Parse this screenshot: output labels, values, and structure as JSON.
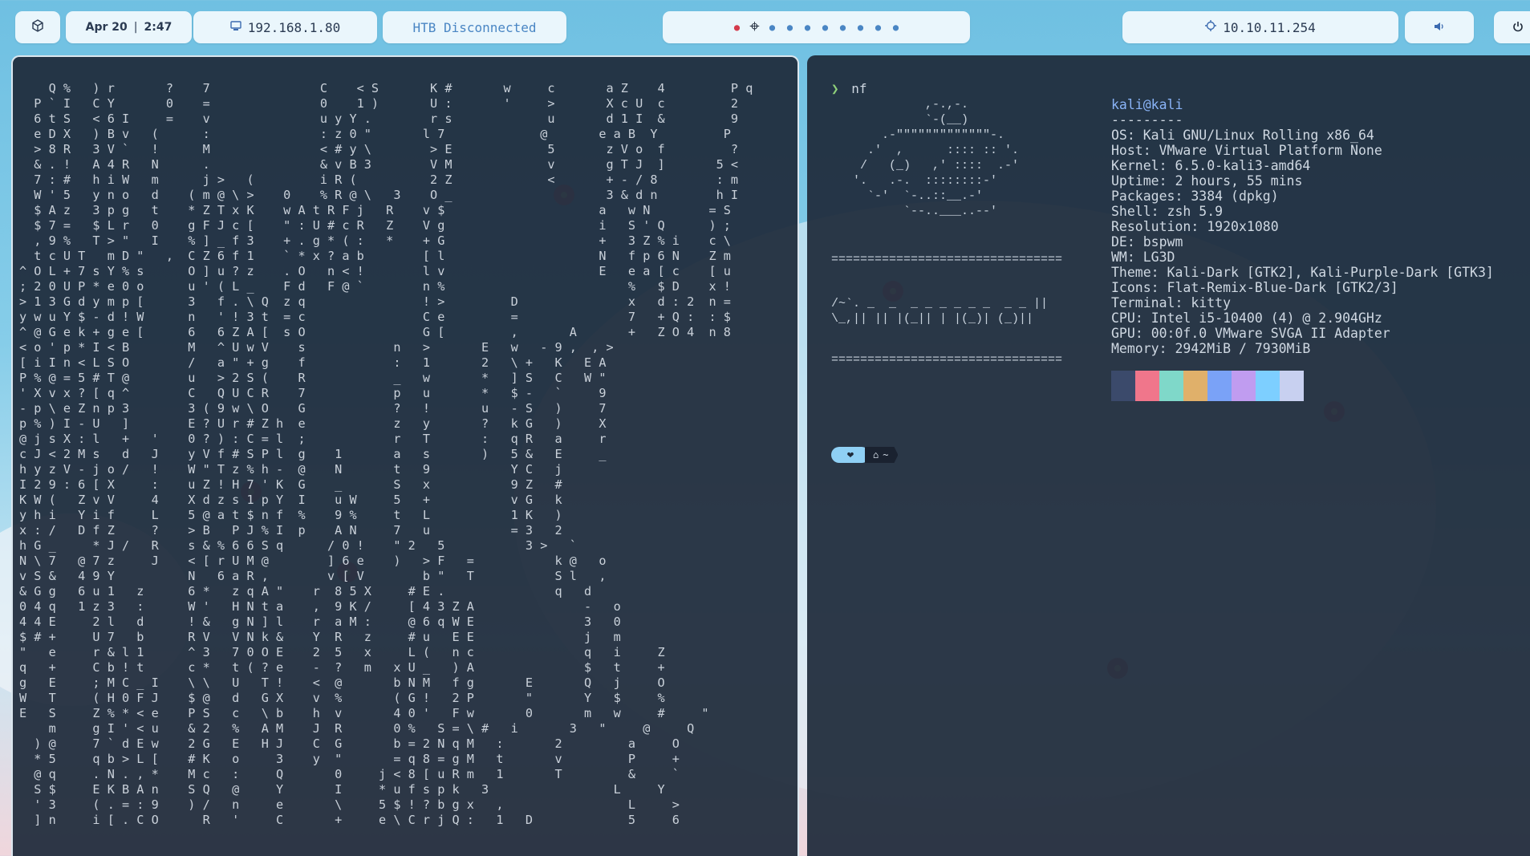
{
  "topbar": {
    "logo_icon": "cube-icon",
    "clock": {
      "date": "Apr 20",
      "time": "2:47"
    },
    "lan": {
      "icon": "network-icon",
      "ip": "192.168.1.80"
    },
    "htb_status": "HTB Disconnected",
    "workspaces": {
      "count": 10,
      "active_index": 1,
      "urgent_index": 0
    },
    "vpn": {
      "icon": "target-icon",
      "ip": "10.10.11.254"
    },
    "volume_icon": "volume-icon",
    "power_icon": "power-icon"
  },
  "left_terminal": {
    "matrix_text": "    Q %   ) r       ?    7               C    < S       K #       w     c       a Z    4         P q\n  P ` I   C Y       0    =               0    1 )       U :       '     >       X c U  c         2\n  6 t S   < 6 I     =    v               u y Y .        r s             u       d 1 I  &         9\n  e D X   ) B v   (      :               : z 0 \"       l 7             @       e a B  Y         P\n  > 8 R   3 V `   !      M               < # y \\        > E             5       z V o  f         ?\n  & . !   A 4 R   N      .               & v B 3        V M             v       g T J  ]       5 <\n  7 : #   h i W   m      j >   (         i R (          2 Z             <       + - / 8        : m\n  W ' 5   y n o   d    ( m @ \\ >    0    % R @ \\   3    O _                     3 & d n        h I\n  $ A z   3 p g   t    * Z T x K    w A t R F j   R    v $                     a   w N        = S\n  $ 7 =   $ L r   0    g F J c [    \" : U # c R   Z    V g                     i   S ' Q      ) ;\n  , 9 %   T > \"   I    % ] _ f 3    + . g * ( :   *    + G                     +   3 Z % i    c \\\n  t c U T   m D \"   ,  C Z 6 f 1    ` * x ? a b        [ l                     N   f p 6 N    Z m\n^ O L + 7 s Y % s      O ] u ? z    . O   n < !        l v                     E   e a [ c    [ u\n; 2 0 U P * e 0 o      u ' ( L _    F d   F @ `        n %                         %   $ D    x !\n> 1 3 G d y m p [      3   f . \\ Q  z q                ! >         D               x   d : 2  n =\ny w u Y $ - d ! W      n   ' ! 3 t  = c                C e         =               7   + Q :  : $\n^ @ G e k + g e [      6   6 Z A [  s O                G [         ,       A       +   Z O 4  n 8\n< o ' p * I < B        M   ^ U w V    s            n   >       E   w   - 9 ,  , >\n[ i I n < L S O        /   a \" + g    f            :   1       2   \\ +   K   E A\nP % @ = 5 # T @        u   > 2 S (    R            _   w       *   ] S   C   W \"\n' X v x ? [ q ^        C   Q U C R    7            p   u       *   $ -   `     9\n- p \\ e Z n p 3        3 ( 9 w \\ O    G            ?   !       u   - S   )     7\np % ) I - U   ]        E ? U r # Z h  e            z   y       ?   k G   )     X\n@ j s X : l   +   '    0 ? ) : C = l  ;            r   T       :   q R   a     r\nc J < 2 M s   d   J    y V f # S P l  g    1       a   s       )   5 &   E     _\nh y z V - j o /   !    W \" T z % h -  @    N       t   9           Y C   j\nI 2 9 : 6 [ X     :    u Z ! H 7 ' K  G    _       S   x           9 Z   #\nK W (   Z v V     4    X d z s 1 p Y  I    u W     5   +           v G   k\ny h i   Y i f     L    5 @ a t $ n f  %    9 %     t   L           1 K   )\nx : /   D f Z     ?    > B   P J % I  p    A N     7   u           = 3   2\nh G _     * J /   R    s & % 6 6 S q      / 0 !    \" 2   5           3 >   `\nN \\ 7   @ 7 z     J    < [ r U M @        ] 6 e    )   > F   =           k @   o\nv S &   4 9 Y          N   6 a R ,        v [ V        b \"   T           S l   ,\n& G g   6 u 1   z      6 *   z q A \"    r  8 5 X     # E .               q   d\n0 4 q   1 z 3   :      W '   H N t a    ,  9 K /     [ 4 3 Z A               -   o\n4 4 E     2 l   d      ! &   g N ] l    r  a M :     @ 6 q W E               3   0\n$ # +     U 7   b      R V   V N k &    Y  R   z     # u   E E               j   m\n\"   e     r & l 1      ^ 3   7 0 O E    2  5   x     L (   n c               q   i     Z\nq   +     C b ! t      c *   t ( ? e    -  ?   m   x U _   ) A               $   t     +\ng   E     ; M C _ I    \\ \\   U   T !    <  @       b N M   f g       E       Q   j     O\nW   T     ( H 0 F J    $ @   d   G X    v  %       ( G !   2 P       \"       Y   $     %\nE   S     Z % * < e    P S   c   \\ b    h  v       4 0 '   F w       0       m   w     #     \"\n    m     g I ' < u    & 2   %   A M    J  R       0 %   S = \\ #   i       3   \"     @     Q\n  ) @     7 ` d E w    2 G   E   H J    C  G       b = 2 N q M   :       2         a     O\n  * 5     q b > L [    # K   o     3    y  \"       = q 8 = g M   t       v         P     +\n  @ q     . N . , *    M c   :     Q       0     j < 8 [ u R m   1       T         &     `\n  S $     E K B A n    S Q   @     Y       I     * u f s p k   3                 L     Y\n  ' 3     ( . = : 9    ) /   n     e       \\     5 $ ! ? b g x   ,                 L     >\n  ] n     i [ . C O      R   '     C       +     e \\ C r j Q :   1   D             5     6"
  },
  "right_terminal": {
    "prompt_symbol": "❯",
    "command": "nf",
    "ascii_mascot": "             ,-.,-.\n             `-(__)\n       .-\"\"\"\"\"\"\"\"\"\"\"\"\"-.\n     .'  ,      :::: :: '.\n    /   (_)   ,' ::::  .-'\n   '.   .-.  ::::::::-'\n     `-'  `-..::__.-'\n          `--..___..--'",
    "rule_top": "================================",
    "ascii_banner_line1": "/~`. _  _  _ _ _ _ _ _  _ _ ||",
    "ascii_banner_line2": "\\_,|| || |(_|| | |(_)| (_)||",
    "rule_bottom": "================================",
    "user_host": "kali@kali",
    "separator": "---------",
    "info": [
      {
        "key": "OS",
        "value": "Kali GNU/Linux Rolling x86_64"
      },
      {
        "key": "Host",
        "value": "VMware Virtual Platform None"
      },
      {
        "key": "Kernel",
        "value": "6.5.0-kali3-amd64"
      },
      {
        "key": "Uptime",
        "value": "2 hours, 55 mins"
      },
      {
        "key": "Packages",
        "value": "3384 (dpkg)"
      },
      {
        "key": "Shell",
        "value": "zsh 5.9"
      },
      {
        "key": "Resolution",
        "value": "1920x1080"
      },
      {
        "key": "DE",
        "value": "bspwm"
      },
      {
        "key": "WM",
        "value": "LG3D"
      },
      {
        "key": "Theme",
        "value": "Kali-Dark [GTK2], Kali-Purple-Dark [GTK3]"
      },
      {
        "key": "Icons",
        "value": "Flat-Remix-Blue-Dark [GTK2/3]"
      },
      {
        "key": "Terminal",
        "value": "kitty"
      },
      {
        "key": "CPU",
        "value": "Intel i5-10400 (4) @ 2.904GHz"
      },
      {
        "key": "GPU",
        "value": "00:0f.0 VMware SVGA II Adapter"
      },
      {
        "key": "Memory",
        "value": "2942MiB / 7930MiB"
      }
    ],
    "palette": [
      "#3b4a6b",
      "#f0768b",
      "#7fd8c9",
      "#e0b06a",
      "#7aa2f7",
      "#c09cf0",
      "#7dcfff",
      "#c8d0f0"
    ],
    "prompt_pill": {
      "heart_icon": "heart-icon",
      "home_icon": "home-icon",
      "path": "~"
    }
  }
}
